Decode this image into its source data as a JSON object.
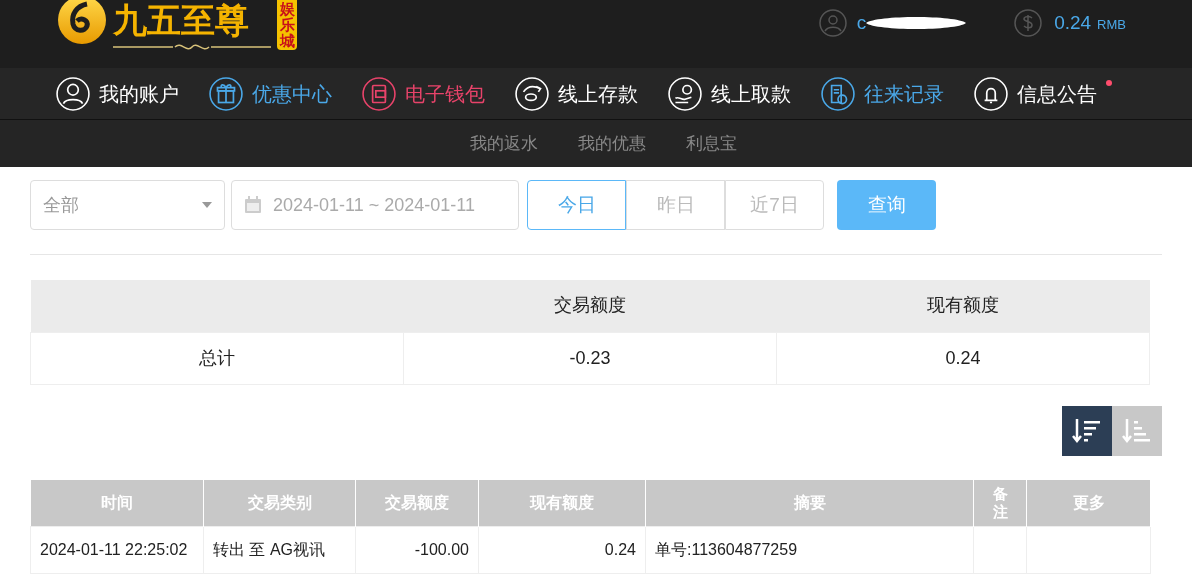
{
  "logo": {
    "title": "九五至尊",
    "subtitle": "娱乐城"
  },
  "user": {
    "name": "c",
    "balance": "0.24",
    "currency": "RMB"
  },
  "nav": [
    {
      "label": "我的账户",
      "kind": "user",
      "color": "#ffffff",
      "badge": false
    },
    {
      "label": "优惠中心",
      "kind": "gift",
      "color": "#4aa8e8",
      "badge": false
    },
    {
      "label": "电子钱包",
      "kind": "wallet",
      "color": "#e8436a",
      "badge": false
    },
    {
      "label": "线上存款",
      "kind": "deposit",
      "color": "#ffffff",
      "badge": false
    },
    {
      "label": "线上取款",
      "kind": "withdraw",
      "color": "#ffffff",
      "badge": false
    },
    {
      "label": "往来记录",
      "kind": "record",
      "color": "#4aa8e8",
      "badge": false
    },
    {
      "label": "信息公告",
      "kind": "bell",
      "color": "#ffffff",
      "badge": true
    }
  ],
  "subnav": [
    "我的返水",
    "我的优惠",
    "利息宝"
  ],
  "filters": {
    "type": "全部",
    "date_range": "2024-01-11 ~ 2024-01-11",
    "quick": [
      {
        "label": "今日",
        "selected": true
      },
      {
        "label": "昨日",
        "selected": false
      },
      {
        "label": "近7日",
        "selected": false
      }
    ],
    "query": "查询"
  },
  "summary": {
    "columns": [
      "",
      "交易额度",
      "现有额度"
    ],
    "rows": [
      [
        "总计",
        "-0.23",
        "0.24"
      ]
    ]
  },
  "sort": [
    {
      "kind": "desc",
      "selected": true
    },
    {
      "kind": "asc",
      "selected": false
    }
  ],
  "table": {
    "columns": [
      "时间",
      "交易类别",
      "交易额度",
      "现有额度",
      "摘要",
      "备注",
      "更多"
    ],
    "rows": [
      [
        "2024-01-11 22:25:02",
        "转出 至 AG视讯",
        "-100.00",
        "0.24",
        "单号:113604877259",
        "",
        ""
      ]
    ]
  }
}
